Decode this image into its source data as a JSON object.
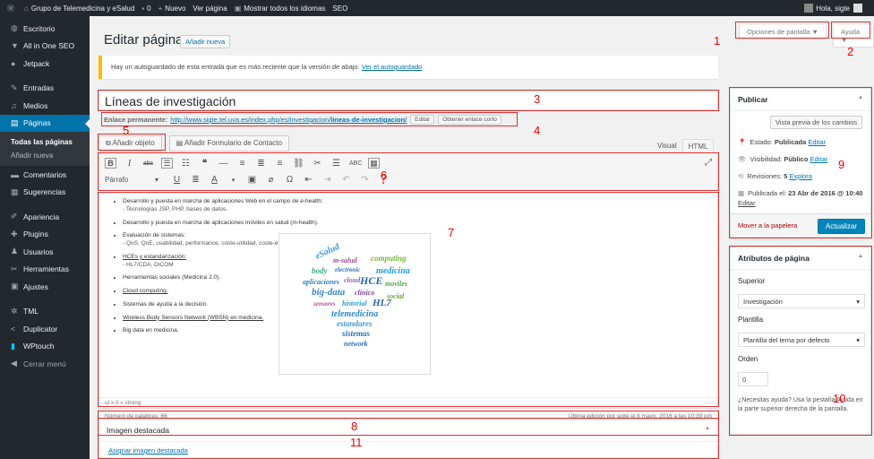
{
  "adminbar": {
    "site_name": "Grupo de Telemedicina y eSalud",
    "comments_count": "0",
    "new_label": "Nuevo",
    "view_page": "Ver página",
    "show_languages": "Mostrar todos los idiomas",
    "seo": "SEO",
    "greeting": "Hola, sigte"
  },
  "sidebar": {
    "items": [
      {
        "label": "Escritorio",
        "icon": "dashboard-icon"
      },
      {
        "label": "All in One SEO",
        "icon": "seo-icon"
      },
      {
        "label": "Jetpack",
        "icon": "jetpack-icon"
      },
      {
        "label": "Entradas",
        "icon": "pin-icon"
      },
      {
        "label": "Medios",
        "icon": "media-icon"
      },
      {
        "label": "Páginas",
        "icon": "pages-icon"
      },
      {
        "label": "Comentarios",
        "icon": "comments-icon"
      },
      {
        "label": "Sugerencias",
        "icon": "suggestions-icon"
      },
      {
        "label": "Apariencia",
        "icon": "appearance-icon"
      },
      {
        "label": "Plugins",
        "icon": "plugins-icon"
      },
      {
        "label": "Usuarios",
        "icon": "users-icon"
      },
      {
        "label": "Herramientas",
        "icon": "tools-icon"
      },
      {
        "label": "Ajustes",
        "icon": "settings-icon"
      },
      {
        "label": "TML",
        "icon": "gear-icon"
      },
      {
        "label": "Duplicator",
        "icon": "duplicator-icon"
      },
      {
        "label": "WPtouch",
        "icon": "wptouch-icon"
      },
      {
        "label": "Cerrar menú",
        "icon": "collapse-icon"
      }
    ],
    "sub_all_pages": "Todas las páginas",
    "sub_add_new": "Añadir nueva"
  },
  "header": {
    "title": "Editar página",
    "add_new": "Añadir nueva",
    "screen_options": "Opciones de pantalla ▼",
    "help": "Ayuda ▼"
  },
  "notice": {
    "text": "Hay un autoguardado de esta entrada que es más reciente que la versión de abajo.",
    "link": "Ver el autoguardado"
  },
  "post": {
    "title": "Líneas de investigación",
    "permalink_label": "Enlace permanente:",
    "permalink_url": "http://www.sigte.tel.uva.es/index.php/es/investigacion/",
    "permalink_slug": "lineas-de-investigacion/",
    "edit_btn": "Editar",
    "shortlink_btn": "Obtener enlace corto"
  },
  "media": {
    "add_object": "Añadir objeto",
    "add_form": "Añadir Formulario de Contacto"
  },
  "tabs": {
    "visual": "Visual",
    "html": "HTML"
  },
  "toolbar": {
    "format": "Párrafo"
  },
  "content": {
    "items": [
      {
        "text": "Desarrollo y puesta en marcha de aplicaciones Web en el campo de e-health:",
        "sub": "- Tecnologías JSP, PHP, bases de datos."
      },
      {
        "text": "Desarrollo y puesta en marcha de aplicaciones móviles en salud (m-health).",
        "sub": ""
      },
      {
        "text": "Evaluación de sistemas:",
        "sub": "- QoS, QoE, usabilidad, performance, coste-utilidad, coste-efectividad."
      },
      {
        "text": "HCEs y estandarización:",
        "sub": "- HL7/CDA, DICOM"
      },
      {
        "text": "Herramientas sociales (Medicina 2.0).",
        "sub": ""
      },
      {
        "text": "Cloud computing.",
        "sub": ""
      },
      {
        "text": "Sistemas de ayuda a la decisión.",
        "sub": ""
      },
      {
        "text": "Wireless Body Sensors Network (WBSN) en medicina.",
        "sub": ""
      },
      {
        "text": "Big data en medicina.",
        "sub": ""
      }
    ]
  },
  "wordcloud": {
    "words": [
      "eSalud",
      "m-salud",
      "computing",
      "body",
      "electronic",
      "medicina",
      "aplicaciones",
      "cloud",
      "HCE",
      "moviles",
      "big-data",
      "clinico",
      "sensores",
      "historial",
      "HL7",
      "social",
      "telemedicina",
      "estandares",
      "sistemas",
      "network"
    ]
  },
  "status": {
    "path": "ul » li » strong",
    "word_count": "Número de palabras: 66",
    "last_edit": "Última edición por sigte el 8 mayo, 2016 a las 10:39 pm"
  },
  "publish": {
    "title": "Publicar",
    "preview": "Vista previa de los cambios",
    "status_label": "Estado:",
    "status_value": "Publicada",
    "visibility_label": "Visibilidad:",
    "visibility_value": "Público",
    "revisions_label": "Revisiones:",
    "revisions_value": "5",
    "revisions_link": "Explora",
    "published_label": "Publicada el:",
    "published_value": "23 Abr de 2016 @ 10:40",
    "edit": "Editar",
    "trash": "Mover a la papelera",
    "update": "Actualizar"
  },
  "attrs": {
    "title": "Atributos de página",
    "parent_label": "Superior",
    "parent_value": "Investigación",
    "template_label": "Plantilla",
    "template_value": "Plantilla del tema por defecto",
    "order_label": "Orden",
    "order_value": "0",
    "help": "¿Necesitas ayuda? Usa la pestaña Ayuda en la parte superior derecha de la pantalla."
  },
  "featured": {
    "title": "Imagen destacada",
    "assign": "Asignar imagen destacada"
  },
  "annotations": [
    "1",
    "2",
    "3",
    "4",
    "5",
    "6",
    "7",
    "8",
    "9",
    "10",
    "11"
  ],
  "colors": {
    "accent": "#0073aa",
    "sidebar": "#23282d",
    "annotation": "#e03030",
    "notice": "#ffb900"
  }
}
